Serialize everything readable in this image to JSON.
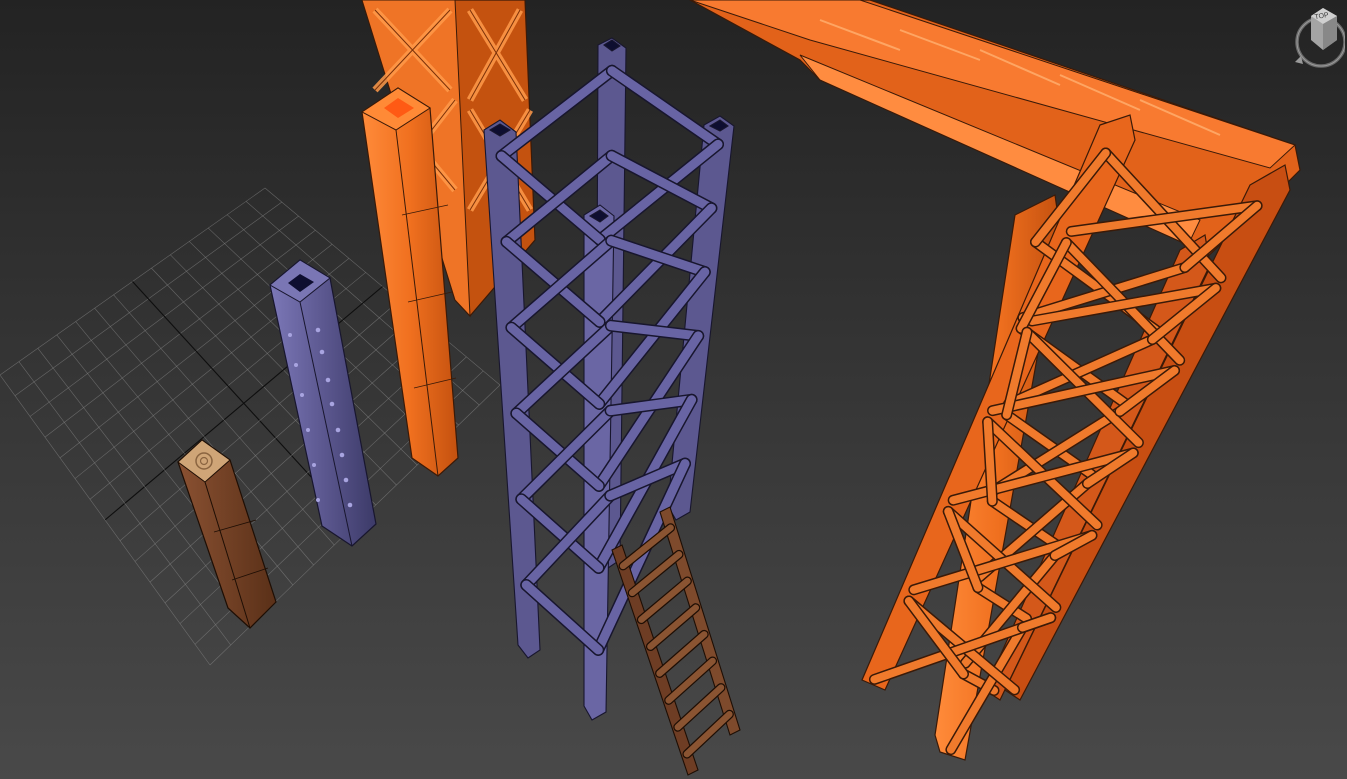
{
  "viewport": {
    "background_top": "#232323",
    "background_bottom": "#494949",
    "grid_color": "#8a8a8a",
    "grid_axis_color": "#0e0e0e"
  },
  "viewcube": {
    "label": "TOP",
    "icon": "viewcube-icon"
  },
  "materials": {
    "orange_truss": "#ea6a1c",
    "orange_highlight": "#ff9a4a",
    "orange_dark": "#a8420e",
    "purple_metal": "#5c5890",
    "purple_highlight": "#8884c4",
    "purple_dark": "#2a2850",
    "wood": "#6e3d24",
    "wood_light": "#c9a070"
  }
}
